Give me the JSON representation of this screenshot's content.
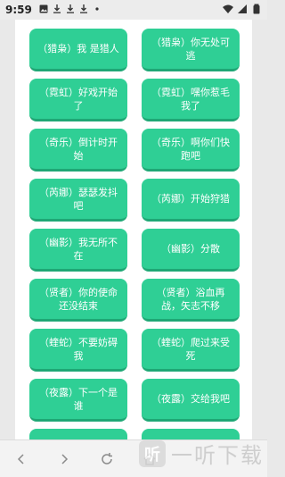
{
  "status_bar": {
    "time": "9:59",
    "notifications": [
      "gallery-icon",
      "download-icon",
      "download-icon",
      "download-icon",
      "dot-icon"
    ],
    "right_icons": [
      "wifi-icon",
      "signal-icon",
      "battery-icon"
    ]
  },
  "buttons": [
    "（猎枭）我 是猎人",
    "（猎枭）你无处可逃",
    "（霓虹）好戏开始了",
    "（霓虹）嘿你惹毛我了",
    "（奇乐）倒计时开始",
    "（奇乐）啊你们快跑吧",
    "（芮娜）瑟瑟发抖吧",
    "（芮娜）开始狩猎",
    "（幽影）我无所不在",
    "（幽影）分散",
    "（贤者）你的使命还没结束",
    "（贤者）浴血再战，矢志不移",
    "（蝰蛇）不要妨碍我",
    "（蝰蛇）爬过来受死",
    "（夜露）下一个是谁",
    "（夜露）交给我吧",
    "",
    ""
  ],
  "nav_bar": {
    "icons": [
      "back-icon",
      "forward-icon",
      "refresh-icon",
      "home-icon",
      "tabs-icon",
      "menu-icon"
    ]
  },
  "watermark": {
    "logo_char": "听",
    "text": "一听下载"
  },
  "colors": {
    "button_bg": "#2fcf95",
    "button_shadow": "#1fa775",
    "page_bg": "#ffffff",
    "outer_bg": "#e9e9e9"
  }
}
